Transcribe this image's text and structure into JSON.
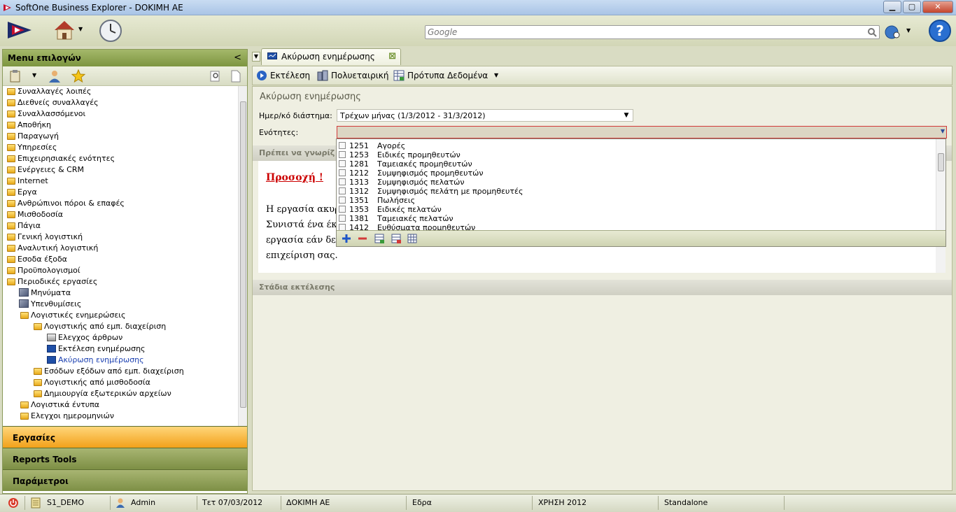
{
  "window": {
    "title": "SoftOne Business Explorer - DOKIMH AE",
    "minimize": "▁",
    "maximize": "▢",
    "close": "✕"
  },
  "toolbar": {
    "search_placeholder": "Google"
  },
  "sidebar": {
    "title": "Menu επιλογών",
    "collapse": "<",
    "items": [
      "Συναλλαγές λοιπές",
      "Διεθνείς συναλλαγές",
      "Συναλλασσόμενοι",
      "Αποθήκη",
      "Παραγωγή",
      "Υπηρεσίες",
      "Επιχειρησιακές ενότητες",
      "Ενέργειες & CRM",
      "Internet",
      "Εργα",
      "Ανθρώπινοι πόροι & επαφές",
      "Μισθοδοσία",
      "Πάγια",
      "Γενική λογιστική",
      "Αναλυτική λογιστική",
      "Εσοδα έξοδα",
      "Προϋπολογισμοί",
      "Περιοδικές εργασίες",
      "Μηνύματα",
      "Υπενθυμίσεις",
      "Λογιστικές ενημερώσεις",
      "Λογιστικής από εμπ. διαχείριση",
      "Ελεγχος άρθρων",
      "Εκτέλεση ενημέρωσης",
      "Ακύρωση ενημέρωσης",
      "Εσόδων εξόδων από εμπ. διαχείριση",
      "Λογιστικής από μισθοδοσία",
      "Δημιουργία εξωτερικών αρχείων",
      "Λογιστικά έντυπα",
      "Ελεγχοι ημερομηνιών"
    ],
    "sections": [
      "Εργασίες",
      "Reports Tools",
      "Παράμετροι"
    ]
  },
  "tab": {
    "label": "Ακύρωση ενημέρωσης",
    "close": "⊠"
  },
  "actions": {
    "execute": "Εκτέλεση",
    "multicompany": "Πολυεταιρική",
    "templates": "Πρότυπα Δεδομένα"
  },
  "form": {
    "title": "Ακύρωση ενημέρωσης",
    "period_label": "Ημερ/κό διάστημα:",
    "period_value": "Τρέχων μήνας (1/3/2012 - 31/3/2012)",
    "modules_label": "Ενότητες:",
    "panel1_title": "Πρέπει να γνωρίζ",
    "caution": "Προσοχή !",
    "body_lines": [
      "Η εργασία ακυρ",
      "Συνιστά ένα έκτ",
      "εργασία εάν δεν",
      "επιχείριση σας."
    ],
    "panel2_title": "Στάδια εκτέλεσης"
  },
  "dropdown": {
    "items": [
      {
        "code": "1251",
        "name": "Αγορές"
      },
      {
        "code": "1253",
        "name": "Ειδικές προμηθευτών"
      },
      {
        "code": "1281",
        "name": "Ταμειακές προμηθευτών"
      },
      {
        "code": "1212",
        "name": "Συμψηφισμός προμηθευτών"
      },
      {
        "code": "1313",
        "name": "Συμψηφισμός πελατών"
      },
      {
        "code": "1312",
        "name": "Συμψηφισμός πελάτη με προμηθευτές"
      },
      {
        "code": "1351",
        "name": "Πωλήσεις"
      },
      {
        "code": "1353",
        "name": "Ειδικές πελατών"
      },
      {
        "code": "1381",
        "name": "Ταμειακές πελατών"
      },
      {
        "code": "1412",
        "name": "Ευθύσματα προμηθευτών"
      }
    ]
  },
  "status": {
    "db": "S1_DEMO",
    "user": "Admin",
    "date": "Τετ 07/03/2012",
    "company": "ΔΟΚΙΜΗ ΑΕ",
    "branch": "Εδρα",
    "year": "ΧΡΗΣΗ 2012",
    "mode": "Standalone"
  },
  "colors": {
    "accent_green": "#7d9540",
    "active_section": "#f2a11a",
    "error_border": "#d23a3a",
    "caution_red": "#cc0000"
  }
}
